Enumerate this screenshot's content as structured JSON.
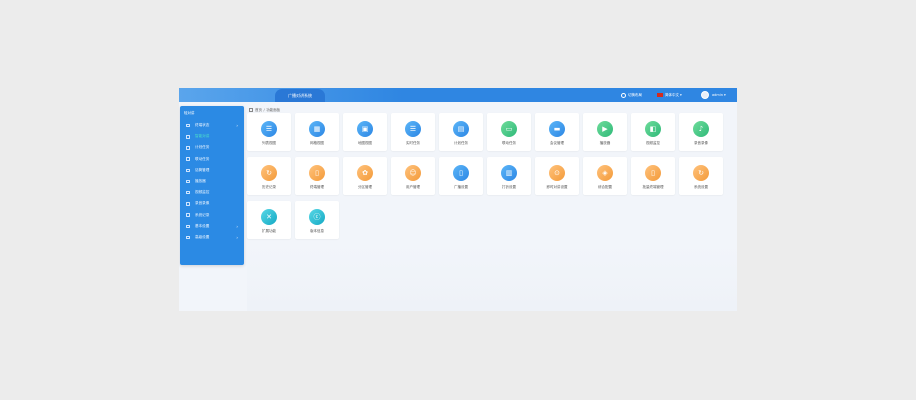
{
  "app": {
    "title": "广播对讲系统"
  },
  "topbar": {
    "layout_item": "切换布局",
    "language": "简体中文",
    "user": "admin"
  },
  "sidebar": {
    "header": "轻对讲",
    "items": [
      {
        "label": "终端状态",
        "has_arrow": true,
        "active": false
      },
      {
        "label": "智能对讲",
        "has_arrow": false,
        "active": true
      },
      {
        "label": "计划任务",
        "has_arrow": false,
        "active": false
      },
      {
        "label": "联动任务",
        "has_arrow": false,
        "active": false
      },
      {
        "label": "话筒管理",
        "has_arrow": false,
        "active": false
      },
      {
        "label": "播放器",
        "has_arrow": false,
        "active": false
      },
      {
        "label": "视频监控",
        "has_arrow": false,
        "active": false
      },
      {
        "label": "录音录像",
        "has_arrow": false,
        "active": false
      },
      {
        "label": "系统记录",
        "has_arrow": false,
        "active": false
      },
      {
        "label": "基本设置",
        "has_arrow": true,
        "active": false
      },
      {
        "label": "高级设置",
        "has_arrow": true,
        "active": false
      }
    ]
  },
  "breadcrumb": {
    "home": "首页",
    "current": "功能面板"
  },
  "tiles": [
    {
      "label": "列表视图",
      "color": "blue",
      "glyph": "☰"
    },
    {
      "label": "网格视图",
      "color": "blue",
      "glyph": "▦"
    },
    {
      "label": "地图视图",
      "color": "blue",
      "glyph": "▣"
    },
    {
      "label": "实时任务",
      "color": "blue",
      "glyph": "☰"
    },
    {
      "label": "计划任务",
      "color": "blue",
      "glyph": "▤"
    },
    {
      "label": "联动任务",
      "color": "green",
      "glyph": "▭"
    },
    {
      "label": "会议管理",
      "color": "blue",
      "glyph": "▬"
    },
    {
      "label": "播放器",
      "color": "green",
      "glyph": "▶"
    },
    {
      "label": "视频监控",
      "color": "green",
      "glyph": "◧"
    },
    {
      "label": "录音录像",
      "color": "green",
      "glyph": "♪"
    },
    {
      "label": "历史记录",
      "color": "orange",
      "glyph": "↻"
    },
    {
      "label": "终端管理",
      "color": "orange",
      "glyph": "▯"
    },
    {
      "label": "分区管理",
      "color": "orange",
      "glyph": "✿"
    },
    {
      "label": "用户管理",
      "color": "orange",
      "glyph": "☺"
    },
    {
      "label": "广播设置",
      "color": "blue",
      "glyph": "▯"
    },
    {
      "label": "打铃设置",
      "color": "blue",
      "glyph": "▥"
    },
    {
      "label": "即时对讲设置",
      "color": "orange",
      "glyph": "⊙"
    },
    {
      "label": "综合配置",
      "color": "orange",
      "glyph": "◈"
    },
    {
      "label": "批量终端管理",
      "color": "orange",
      "glyph": "▯"
    },
    {
      "label": "系统设置",
      "color": "orange",
      "glyph": "↻"
    },
    {
      "label": "扩展功能",
      "color": "teal",
      "glyph": "✕"
    },
    {
      "label": "版本信息",
      "color": "teal",
      "glyph": "ⓒ"
    }
  ]
}
